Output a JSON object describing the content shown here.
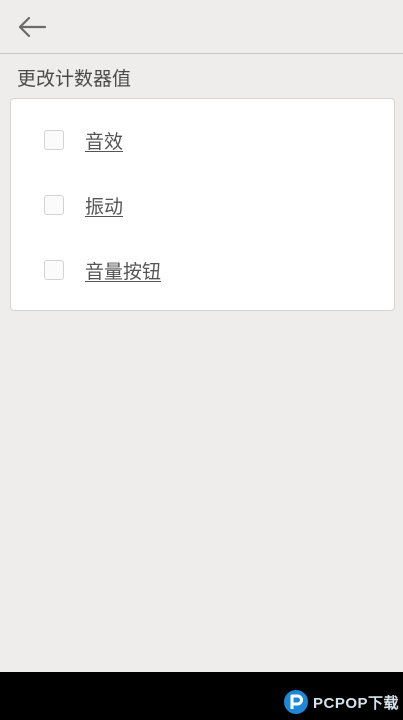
{
  "header": {
    "back_icon": "arrow-left-icon"
  },
  "section": {
    "title": "更改计数器值"
  },
  "options": [
    {
      "label": "音效",
      "checked": false
    },
    {
      "label": "振动",
      "checked": false
    },
    {
      "label": "音量按钮",
      "checked": false
    }
  ],
  "watermark": {
    "text": "PCPOP下载",
    "icon": "pcpop-logo-icon",
    "color": "#1e88d8"
  },
  "colors": {
    "background": "#eeedeb",
    "card": "#ffffff",
    "navbar": "#000000"
  }
}
